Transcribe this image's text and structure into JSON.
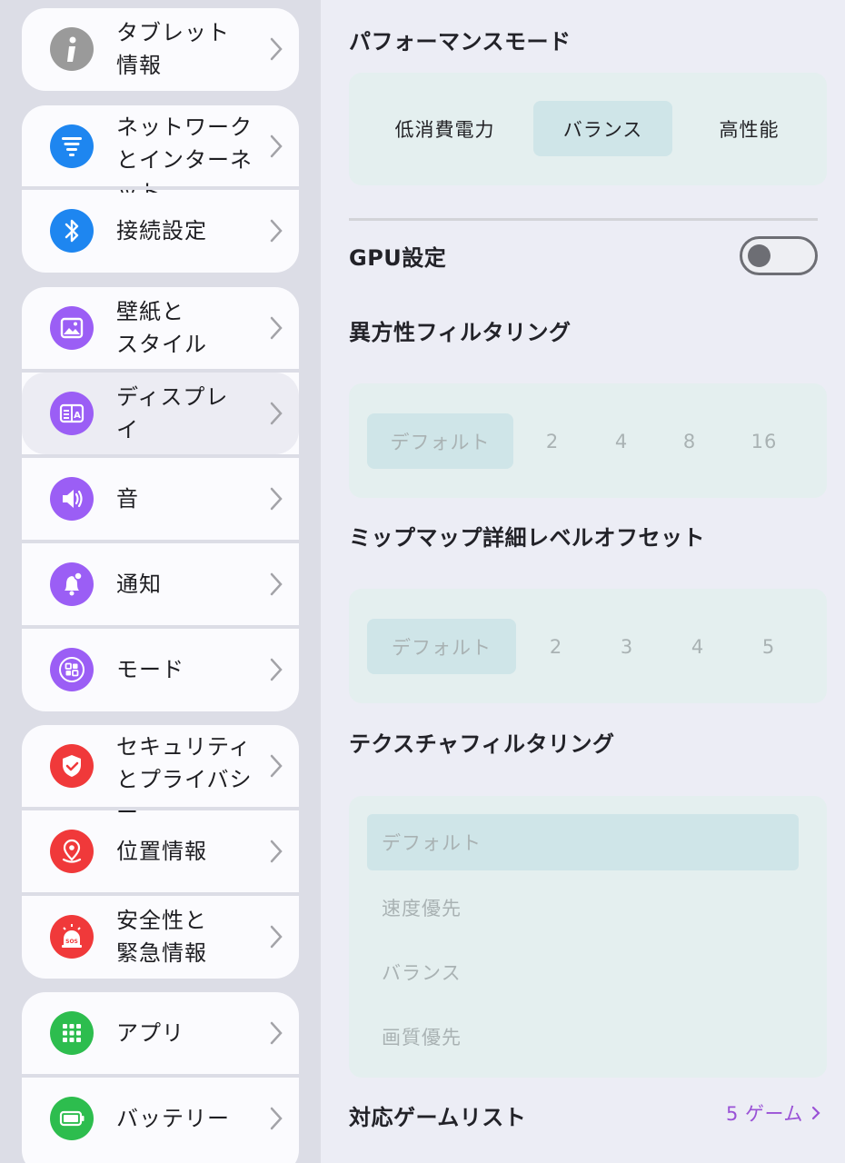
{
  "sidebar": {
    "items": [
      {
        "label": "タブレット\n情報",
        "icon": "info-icon",
        "color": "#9a9a9a"
      },
      {
        "label": "ネットワークとインターネット",
        "icon": "network-icon",
        "color": "#1e86f0"
      },
      {
        "label": "接続設定",
        "icon": "bluetooth-icon",
        "color": "#1e86f0"
      },
      {
        "label": "壁紙と\nスタイル",
        "icon": "wallpaper-icon",
        "color": "#9b5ef5"
      },
      {
        "label": "ディスプレ\nイ",
        "icon": "display-icon",
        "color": "#9b5ef5"
      },
      {
        "label": "音",
        "icon": "speaker-icon",
        "color": "#9b5ef5"
      },
      {
        "label": "通知",
        "icon": "bell-icon",
        "color": "#9b5ef5"
      },
      {
        "label": "モード",
        "icon": "modes-icon",
        "color": "#9b5ef5"
      },
      {
        "label": "セキュリティとプライバシー",
        "icon": "shield-icon",
        "color": "#f0393a"
      },
      {
        "label": "位置情報",
        "icon": "location-icon",
        "color": "#f0393a"
      },
      {
        "label": "安全性と\n緊急情報",
        "icon": "sos-icon",
        "color": "#f0393a"
      },
      {
        "label": "アプリ",
        "icon": "apps-grid-icon",
        "color": "#2dbd4e"
      },
      {
        "label": "バッテリー",
        "icon": "battery-icon",
        "color": "#2dbd4e"
      }
    ]
  },
  "main": {
    "performance": {
      "title": "パフォーマンスモード",
      "options": [
        "低消費電力",
        "バランス",
        "高性能"
      ],
      "selected": "バランス"
    },
    "gpu": {
      "title": "GPU設定",
      "enabled": false
    },
    "anisotropic": {
      "title": "異方性フィルタリング",
      "options": [
        "デフォルト",
        "2",
        "4",
        "8",
        "16"
      ],
      "selected": "デフォルト"
    },
    "mipmap": {
      "title": "ミップマップ詳細レベルオフセット",
      "options": [
        "デフォルト",
        "2",
        "3",
        "4",
        "5"
      ],
      "selected": "デフォルト"
    },
    "texture": {
      "title": "テクスチャフィルタリング",
      "options": [
        "デフォルト",
        "速度優先",
        "バランス",
        "画質優先"
      ],
      "selected": "デフォルト"
    },
    "games": {
      "title": "対応ゲームリスト",
      "link": "5 ゲーム"
    }
  },
  "colors": {
    "accent_link": "#9a52d6",
    "segment_active": "#cfe5e8",
    "panel_bg": "#e4efef"
  }
}
